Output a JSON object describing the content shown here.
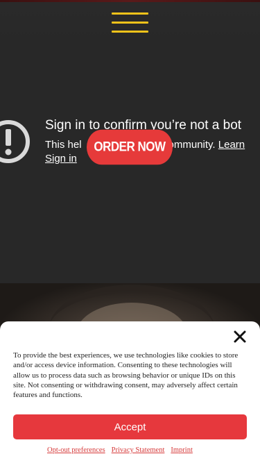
{
  "header": {
    "menu_icon": "hamburger-menu-icon",
    "accent_color": "#f3c31a"
  },
  "video": {
    "error_icon": "exclamation-circle-icon",
    "title": "Sign in to confirm you’re not a bot",
    "body_prefix": "This hel",
    "body_suffix": "ommunity. ",
    "learn_more": "Learn",
    "sign_in": "Sign in"
  },
  "cta": {
    "order_now": "ORDER NOW",
    "color": "#e63a3a"
  },
  "cookie_banner": {
    "close_icon": "close-icon",
    "text": "To provide the best experiences, we use technologies like cookies to store and/or access device information. Consenting to these technologies will allow us to process data such as browsing behavior or unique IDs on this site. Not consenting or withdrawing consent, may adversely affect certain features and functions.",
    "accept_label": "Accept",
    "accept_color": "#e6383d",
    "links": [
      "Opt-out preferences",
      "Privacy Statement",
      "Imprint"
    ]
  }
}
